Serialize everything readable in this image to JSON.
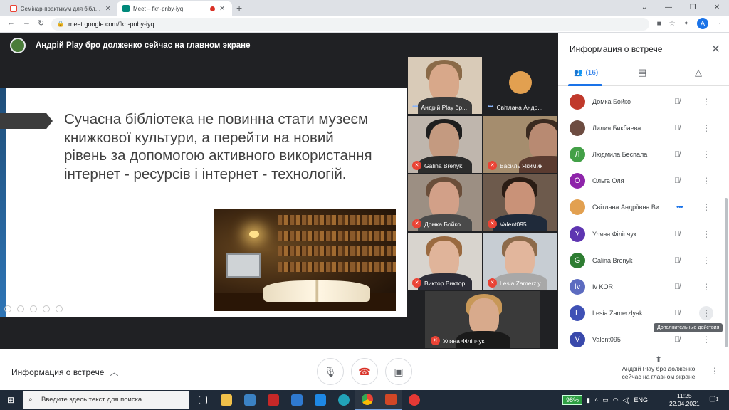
{
  "browser": {
    "tabs": [
      {
        "title": "Семінар-практикум для бібліот",
        "favicon_color": "#ea4335"
      },
      {
        "title": "Meet – fkn-pnby-iyq",
        "favicon_color": "#00897b"
      }
    ],
    "url": "meet.google.com/fkn-pnby-iyq",
    "profile_initial": "A"
  },
  "meet": {
    "presenter_banner": "Андрій Play бро долженко сейчас на главном экране",
    "slide_text": "Сучасна бібліотека не повинна стати музеєм книжкової культури, а перейти на новий рівень за допомогою активного використання інтернет - ресурсів і інтернет - технологій.",
    "tiles": [
      {
        "name": "Андрій Play бр..."
      },
      {
        "name": "Світлана Андр..."
      },
      {
        "name": "Galina Brenyk"
      },
      {
        "name": "Василь Якимик"
      },
      {
        "name": "Домка Бойко"
      },
      {
        "name": "Valent095"
      },
      {
        "name": "Виктор Виктор..."
      },
      {
        "name": "Lesia Zamerzly..."
      },
      {
        "name": "Уляна Філіпчук"
      }
    ]
  },
  "panel": {
    "title": "Информация о встрече",
    "people_count": "(16)",
    "participants": [
      {
        "name": "Домка Бойко",
        "initial": "",
        "color": "#c0392b"
      },
      {
        "name": "Лилия Бикбаева",
        "initial": "",
        "color": "#6d4c41"
      },
      {
        "name": "Людмила Беспала",
        "initial": "Л",
        "color": "#43a047"
      },
      {
        "name": "Ольга Оля",
        "initial": "О",
        "color": "#8e24aa"
      },
      {
        "name": "Світлана Андріївна Ви...",
        "initial": "",
        "color": "#e2a050"
      },
      {
        "name": "Уляна Філіпчук",
        "initial": "У",
        "color": "#5e35b1"
      },
      {
        "name": "Galina Brenyk",
        "initial": "G",
        "color": "#2e7d32"
      },
      {
        "name": "Iv KOR",
        "initial": "Iv",
        "color": "#5c6bc0"
      },
      {
        "name": "Lesia Zamerzlyak",
        "initial": "L",
        "color": "#3f51b5"
      },
      {
        "name": "Valent095",
        "initial": "V",
        "color": "#3949ab"
      }
    ],
    "tooltip": "Дополнительные действия"
  },
  "bottom": {
    "info_label": "Информация о встрече",
    "present_text": "Андрій Play бро долженко сейчас на главном экране"
  },
  "taskbar": {
    "search_placeholder": "Введите здесь текст для поиска",
    "battery": "98%",
    "lang": "ENG",
    "time": "11:25",
    "date": "22.04.2021",
    "notifications": "1"
  }
}
